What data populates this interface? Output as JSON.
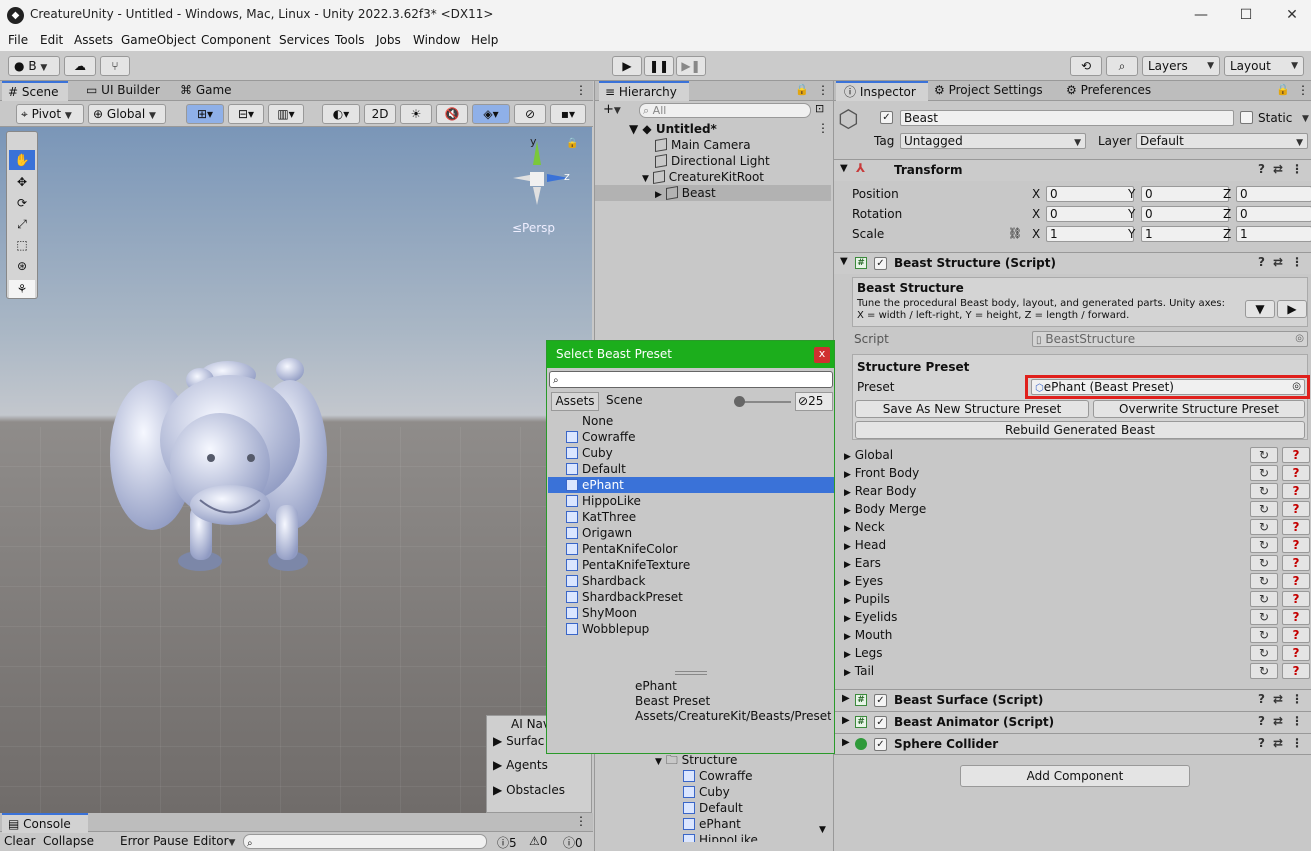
{
  "window": {
    "title": "CreatureUnity - Untitled - Windows, Mac, Linux - Unity 2022.3.62f3* <DX11>",
    "minimize": "—",
    "maximize": "☐",
    "close": "✕"
  },
  "menu": [
    "File",
    "Edit",
    "Assets",
    "GameObject",
    "Component",
    "Services",
    "Tools",
    "Jobs",
    "Window",
    "Help"
  ],
  "toolbar": {
    "account": "B",
    "layers": "Layers",
    "layout": "Layout"
  },
  "scene_tabs": {
    "scene": "Scene",
    "ui_builder": "UI Builder",
    "game": "Game"
  },
  "scene_toolbar": {
    "pivot": "Pivot",
    "global": "Global",
    "mode_2d": "2D"
  },
  "gizmo": {
    "y": "y",
    "z": "z",
    "persp": "≤Persp"
  },
  "ai_nav": {
    "title": "AI Nav",
    "items": [
      "Surfac",
      "Agents",
      "Obstacles"
    ]
  },
  "hierarchy": {
    "title": "Hierarchy",
    "search_placeholder": "All",
    "add": "+",
    "root": "Untitled*",
    "items": [
      "Main Camera",
      "Directional Light",
      "CreatureKitRoot",
      "Beast"
    ]
  },
  "project": {
    "folder": "Structure",
    "items": [
      "Cowraffe",
      "Cuby",
      "Default",
      "ePhant",
      "HippoLike"
    ]
  },
  "console": {
    "title": "Console",
    "clear": "Clear",
    "collapse": "Collapse",
    "error_pause": "Error Pause",
    "editor": "Editor",
    "count_info": "5",
    "count_warn": "0",
    "count_error": "0"
  },
  "inspector_tabs": {
    "inspector": "Inspector",
    "project_settings": "Project Settings",
    "preferences": "Preferences"
  },
  "object": {
    "name": "Beast",
    "static": "Static",
    "tag_label": "Tag",
    "tag": "Untagged",
    "layer_label": "Layer",
    "layer": "Default"
  },
  "transform": {
    "title": "Transform",
    "position": "Position",
    "rotation": "Rotation",
    "scale": "Scale",
    "x": "X",
    "y": "Y",
    "z": "Z",
    "pos": [
      "0",
      "0",
      "0"
    ],
    "rot": [
      "0",
      "0",
      "0"
    ],
    "scl": [
      "1",
      "1",
      "1"
    ]
  },
  "beast_structure": {
    "title": "Beast Structure (Script)",
    "heading": "Beast Structure",
    "description": "Tune the procedural Beast body, layout, and generated parts. Unity axes: X = width / left-right, Y = height, Z = length / forward.",
    "script_label": "Script",
    "script_value": "BeastStructure",
    "preset_heading": "Structure Preset",
    "preset_label": "Preset",
    "preset_value": "ePhant (Beast Preset)",
    "save_button": "Save As New Structure Preset",
    "overwrite_button": "Overwrite Structure Preset",
    "rebuild_button": "Rebuild Generated Beast",
    "sections": [
      "Global",
      "Front Body",
      "Rear Body",
      "Body Merge",
      "Neck",
      "Head",
      "Ears",
      "Eyes",
      "Pupils",
      "Eyelids",
      "Mouth",
      "Legs",
      "Tail"
    ],
    "reset_glyph": "↻",
    "help_glyph": "?"
  },
  "components": [
    "Beast Surface (Script)",
    "Beast Animator (Script)",
    "Sphere Collider"
  ],
  "add_component": "Add Component",
  "picker": {
    "title": "Select Beast Preset",
    "close": "x",
    "tab_assets": "Assets",
    "tab_scene": "Scene",
    "count": "25",
    "slider_level": 0.0,
    "items": [
      "None",
      "Cowraffe",
      "Cuby",
      "Default",
      "ePhant",
      "HippoLike",
      "KatThree",
      "Origawn",
      "PentaKnifeColor",
      "PentaKnifeTexture",
      "Shardback",
      "ShardbackPreset",
      "ShyMoon",
      "Wobblepup"
    ],
    "selected_index": 4,
    "detail_name": "ePhant",
    "detail_type": "Beast Preset",
    "detail_path": "Assets/CreatureKit/Beasts/Presets"
  },
  "colors": {
    "accent": "#3a72d8",
    "picker_header": "#1cae1c",
    "highlight": "#e0201c",
    "help_red": "#c40000"
  }
}
